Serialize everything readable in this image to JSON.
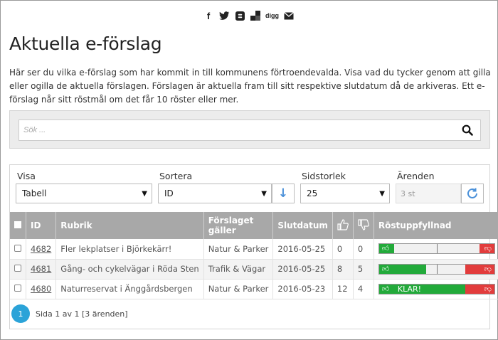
{
  "share": {
    "icons": [
      "facebook-icon",
      "twitter-icon",
      "blogger-icon",
      "delicious-icon",
      "digg-icon",
      "mail-icon"
    ],
    "digg_label": "digg"
  },
  "page": {
    "title": "Aktuella e-förslag",
    "intro": "Här ser du vilka e-förslag som har kommit in till kommunens förtroendevalda. Visa vad du tycker genom att gilla eller ogilla de aktuella förslagen. Förslagen är aktuella fram till sitt respektive slutdatum då de arkiveras. Ett e-förslag når sitt röstmål om det får 10 röster eller mer."
  },
  "search": {
    "placeholder": "Sök ..."
  },
  "controls": {
    "visa_label": "Visa",
    "visa_value": "Tabell",
    "sortera_label": "Sortera",
    "sortera_value": "ID",
    "sidstorlek_label": "Sidstorlek",
    "sidstorlek_value": "25",
    "arenden_label": "Ärenden",
    "arenden_value": "3 st"
  },
  "table": {
    "headers": {
      "id": "ID",
      "rubrik": "Rubrik",
      "galler": "Förslaget gäller",
      "slut": "Slutdatum",
      "progress": "Röstuppfyllnad"
    },
    "rows": [
      {
        "id": "4682",
        "rubrik": "Fler lekplatser i Björkekärr!",
        "galler": "Natur & Parker",
        "slut": "2016-05-25",
        "up": "0",
        "down": "0",
        "klar": ""
      },
      {
        "id": "4681",
        "rubrik": "Gång- och cykelvägar i Röda Sten",
        "galler": "Trafik & Vägar",
        "slut": "2016-05-25",
        "up": "8",
        "down": "5",
        "klar": ""
      },
      {
        "id": "4680",
        "rubrik": "Naturreservat i Änggårdsbergen",
        "galler": "Natur & Parker",
        "slut": "2016-05-23",
        "up": "12",
        "down": "4",
        "klar": "KLAR!"
      }
    ]
  },
  "vote_levels": [
    {
      "yes_fraction": 0.13,
      "no_fraction": 0.13
    },
    {
      "yes_fraction": 0.41,
      "no_fraction": 0.25
    },
    {
      "yes_fraction": 0.75,
      "no_fraction": 0.25
    }
  ],
  "pager": {
    "page": "1",
    "text": "Sida 1 av 1 [3 ärenden]"
  },
  "colors": {
    "header_bg": "#a8a8a8",
    "yes": "#22aa3a",
    "no": "#e23c3c",
    "accent": "#2ba3d8"
  }
}
